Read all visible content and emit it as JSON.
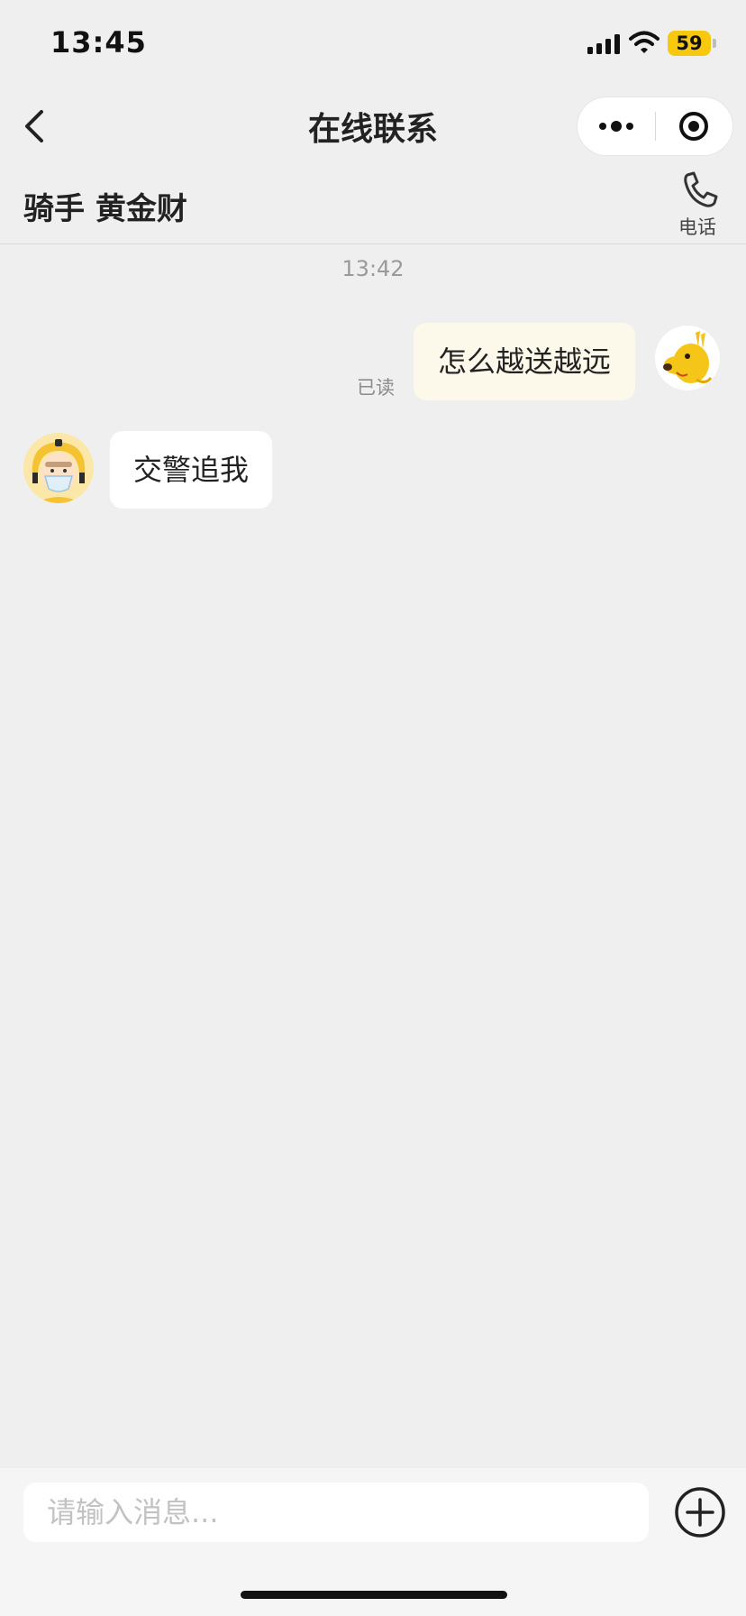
{
  "status_bar": {
    "time": "13:45",
    "battery": "59",
    "icons": [
      "signal-icon",
      "wifi-icon",
      "battery-icon"
    ]
  },
  "nav": {
    "title": "在线联系",
    "icons": [
      "back-arrow-icon",
      "more-dots-icon",
      "close-target-icon"
    ]
  },
  "rider": {
    "name": "骑手 黄金财",
    "phone_label": "电话",
    "phone_icon": "phone-icon"
  },
  "chat": {
    "timestamp": "13:42",
    "messages": [
      {
        "direction": "sent",
        "text": "怎么越送越远",
        "status": "已读",
        "avatar": "yellow-kangaroo-avatar"
      },
      {
        "direction": "received",
        "text": "交警追我",
        "avatar": "rider-helmet-avatar"
      }
    ]
  },
  "input": {
    "placeholder": "请输入消息...",
    "add_icon": "plus-circle-icon"
  },
  "colors": {
    "background": "#efefef",
    "sent_bubble": "#fcf8ea",
    "received_bubble": "#ffffff",
    "battery": "#f6c90e"
  }
}
